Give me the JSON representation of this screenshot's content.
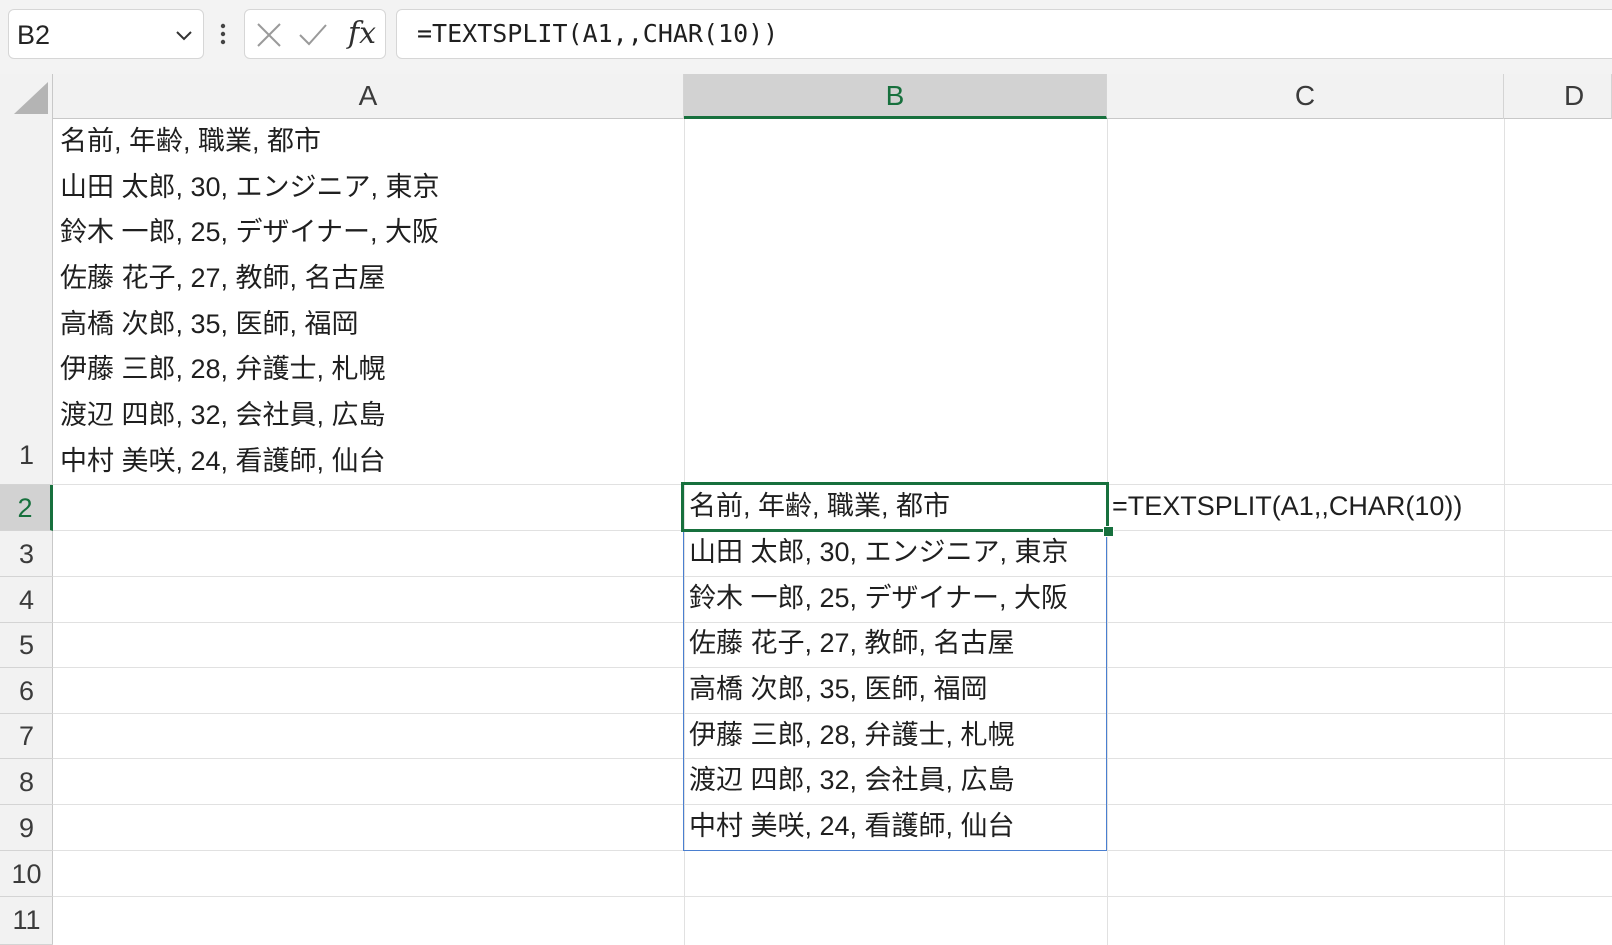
{
  "formula_bar": {
    "name_box": "B2",
    "formula": "=TEXTSPLIT(A1,,CHAR(10))",
    "fx_label": "fx",
    "icons": [
      "chevron-down-icon",
      "more-options-icon",
      "cancel-icon",
      "enter-icon",
      "insert-function-icon"
    ]
  },
  "columns": [
    "A",
    "B",
    "C",
    "D"
  ],
  "rows": [
    "1",
    "2",
    "3",
    "4",
    "5",
    "6",
    "7",
    "8",
    "9",
    "10",
    "11"
  ],
  "cells": {
    "A1": [
      "名前, 年齢, 職業, 都市",
      "山田 太郎, 30, エンジニア, 東京",
      "鈴木 一郎, 25, デザイナー, 大阪",
      "佐藤 花子, 27, 教師, 名古屋",
      "高橋 次郎, 35, 医師, 福岡",
      "伊藤 三郎, 28, 弁護士, 札幌",
      "渡辺 四郎, 32, 会社員, 広島",
      "中村 美咲, 24, 看護師, 仙台"
    ],
    "B_spill": [
      "名前, 年齢, 職業, 都市",
      "山田 太郎, 30, エンジニア, 東京",
      "鈴木 一郎, 25, デザイナー, 大阪",
      "佐藤 花子, 27, 教師, 名古屋",
      "高橋 次郎, 35, 医師, 福岡",
      "伊藤 三郎, 28, 弁護士, 札幌",
      "渡辺 四郎, 32, 会社員, 広島",
      "中村 美咲, 24, 看護師, 仙台"
    ],
    "C2": "=TEXTSPLIT(A1,,CHAR(10))"
  },
  "colors": {
    "selection_green": "#17703d",
    "spill_blue": "#4a7fd0",
    "header_bg": "#f2f2f2"
  }
}
